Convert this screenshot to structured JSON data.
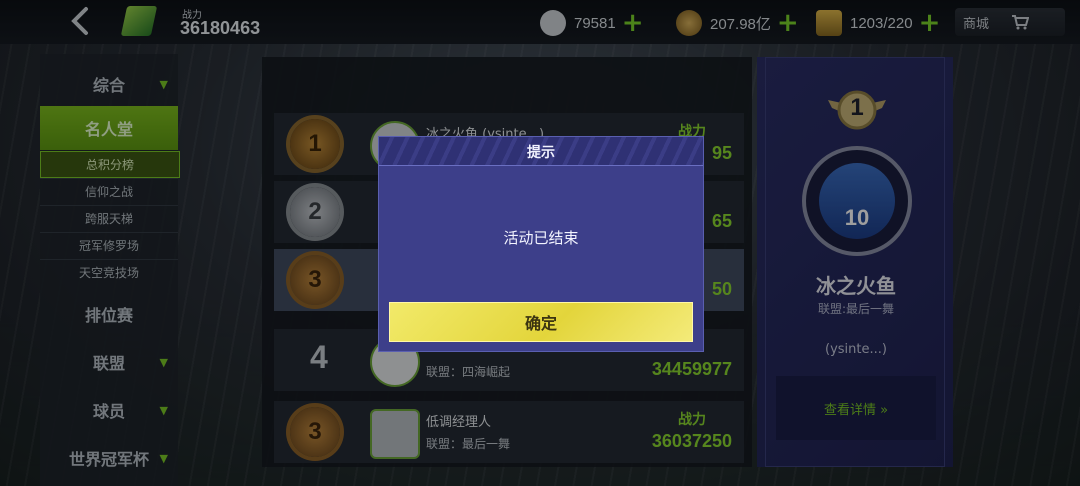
{
  "topbar": {
    "power_label": "战力",
    "power_value": "36180463",
    "resources": [
      {
        "icon": "card-icon",
        "value": "79581"
      },
      {
        "icon": "coin-icon",
        "value": "207.98亿"
      },
      {
        "icon": "stamina-icon",
        "value": "1203/220"
      }
    ],
    "shop_label": "商城"
  },
  "leftnav": {
    "items": [
      {
        "label": "综合",
        "has_arrow": true
      },
      {
        "label": "名人堂",
        "active": true
      },
      {
        "label": "排位赛"
      },
      {
        "label": "联盟",
        "has_arrow": true
      },
      {
        "label": "球员",
        "has_arrow": true
      },
      {
        "label": "世界冠军杯",
        "has_arrow": true
      }
    ],
    "subitems": [
      {
        "label": "总积分榜",
        "active": true
      },
      {
        "label": "信仰之战"
      },
      {
        "label": "跨服天梯"
      },
      {
        "label": "冠军修罗场"
      },
      {
        "label": "天空竞技场"
      }
    ],
    "arrow_glyph": "▼"
  },
  "list": {
    "rows": [
      {
        "rank": "1",
        "name": "冰之火鱼 (ysinte...)",
        "label": "战力",
        "value": "95"
      },
      {
        "rank": "2",
        "value": "65"
      },
      {
        "rank": "3",
        "value": "50"
      },
      {
        "rank": "4",
        "guild": "联盟：四海崛起",
        "value": "34459977"
      },
      {
        "rank": "3",
        "name": "低调经理人",
        "guild": "联盟：最后一舞",
        "label": "战力",
        "value": "36037250"
      }
    ]
  },
  "card": {
    "rank": "1",
    "jersey_number": "10",
    "name": "冰之火鱼",
    "guild": "联盟:最后一舞",
    "tag": "(ysinte...)",
    "details_button": "查看详情 »"
  },
  "modal": {
    "title": "提示",
    "message": "活动已结束",
    "confirm_label": "确定"
  },
  "colors": {
    "accent_green": "#7bc828",
    "modal_bg": "#3d3f8a",
    "button_yellow": "#e3d53b"
  }
}
